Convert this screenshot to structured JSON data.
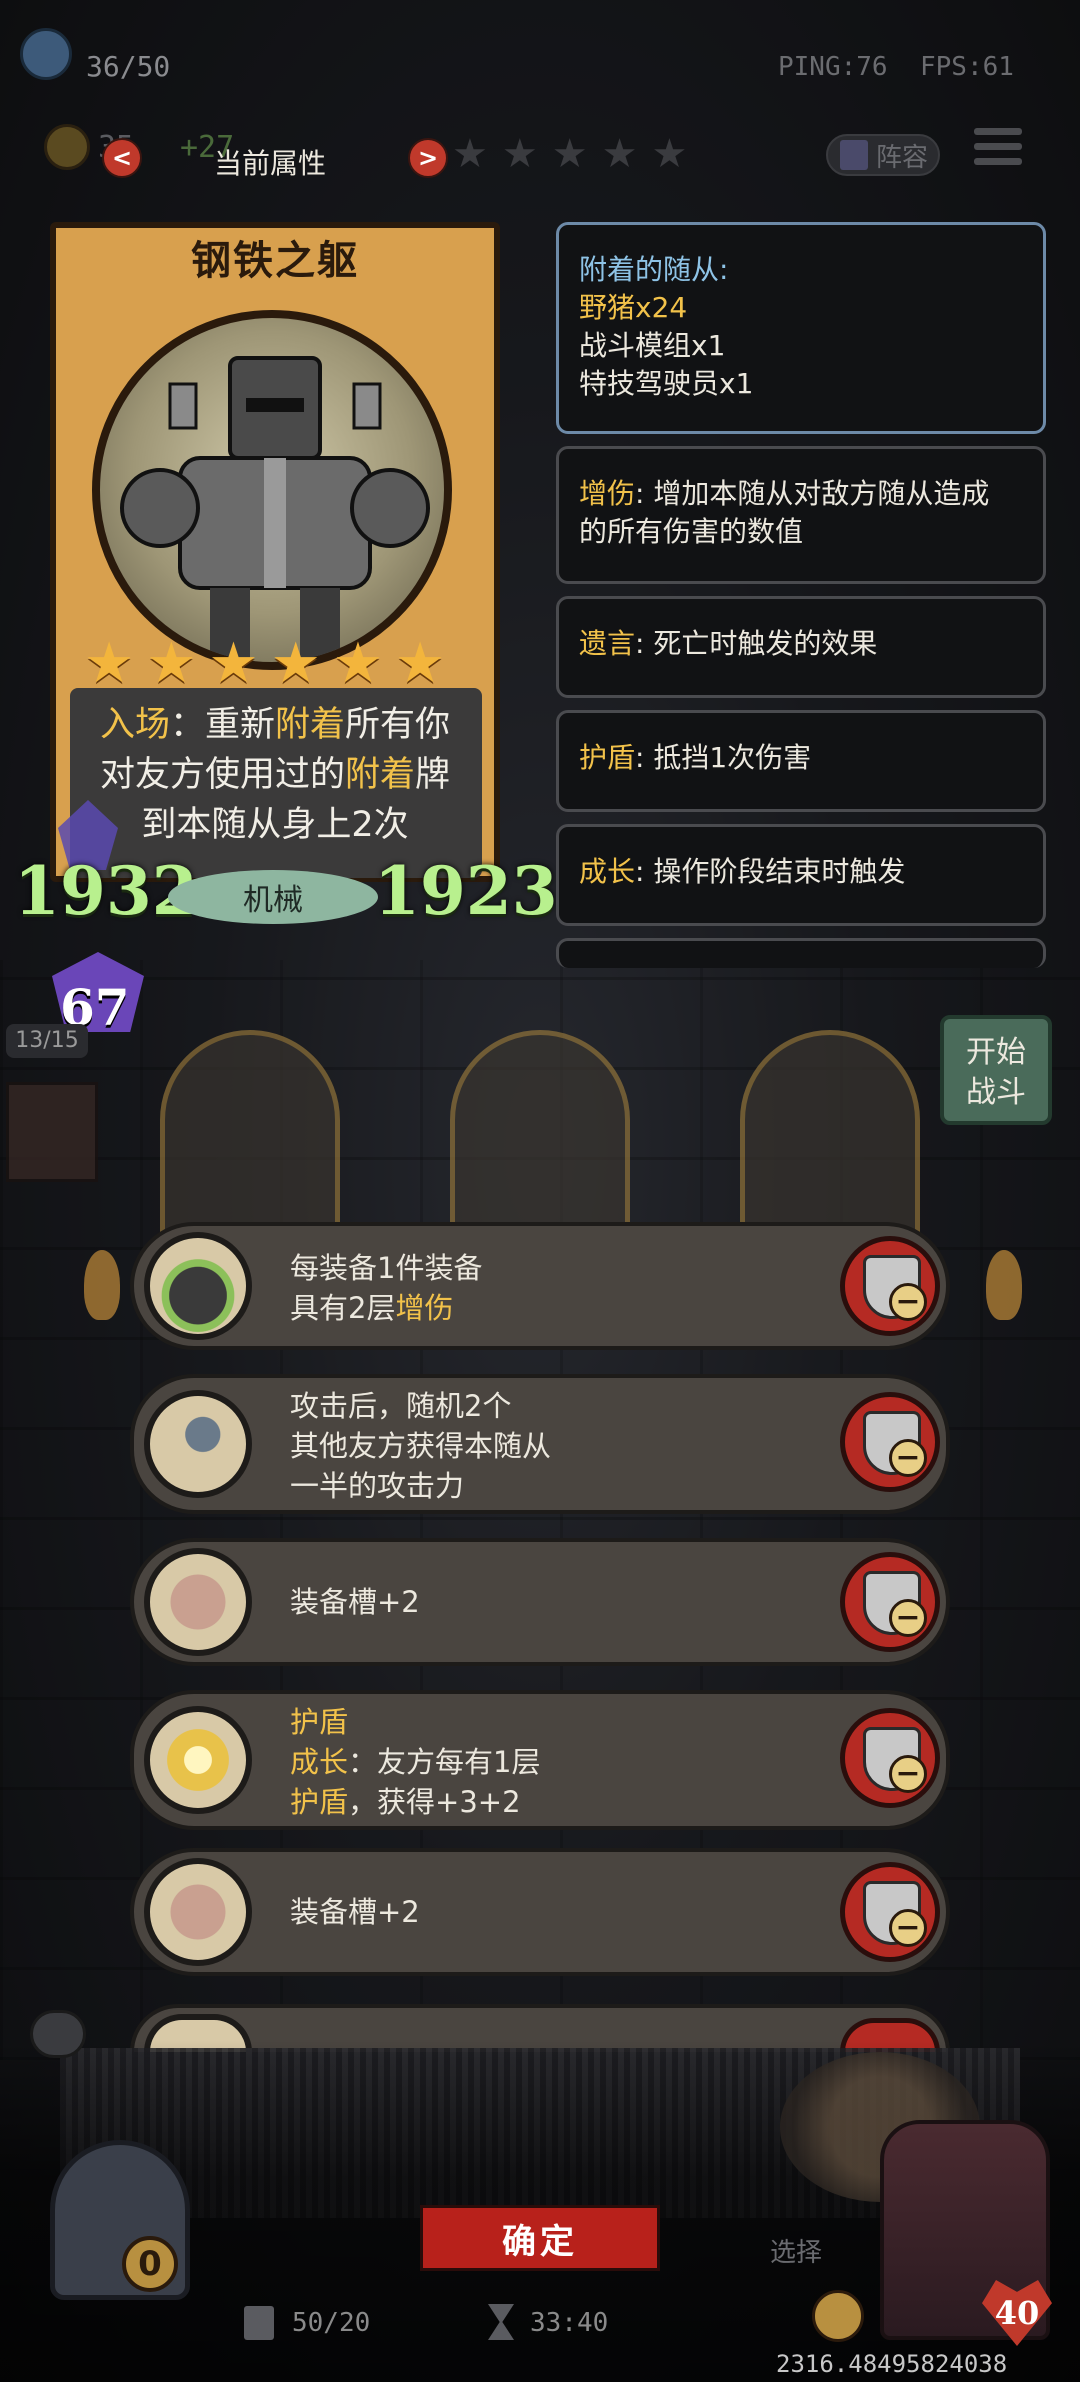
{
  "hud": {
    "gold_count": "36/50",
    "coins": "35",
    "coins_bonus": "+27",
    "ping": "PING:76",
    "fps": "FPS:61",
    "lineup_label": "阵容",
    "attribute_tab": "当前属性",
    "nav_prev": "<",
    "nav_next": ">"
  },
  "card": {
    "name": "钢铁之躯",
    "star_count": 6,
    "desc_line1_prefix": "入场",
    "desc_line1_rest": "：重新",
    "desc_line1_kw": "附着",
    "desc_line1_tail": "所有你",
    "desc_line2_prefix": "对友方使用过的",
    "desc_line2_kw": "附着",
    "desc_line2_tail": "牌",
    "desc_line3": "到本随从身上2次",
    "attack": "1932",
    "health": "1923",
    "tribe": "机械",
    "tier": "67"
  },
  "panels": {
    "attached_title": "附着的随从:",
    "attached_items": [
      "野猪x24",
      "战斗模组x1",
      "特技驾驶员x1"
    ],
    "bonus_damage_kw": "增伤",
    "bonus_damage_text": ": 增加本随从对敌方随从造成",
    "bonus_damage_text2": "的所有伤害的数值",
    "deathrattle_kw": "遗言",
    "deathrattle_text": ": 死亡时触发的效果",
    "shield_kw": "护盾",
    "shield_text": ": 抵挡1次伤害",
    "growth_kw": "成长",
    "growth_text": ": 操作阶段结束时触发"
  },
  "board": {
    "minion_count": "13/15",
    "start_battle_line1": "开始",
    "start_battle_line2": "战斗"
  },
  "options": [
    {
      "line1": "每装备1件装备",
      "line2_prefix": "具有2层",
      "line2_kw": "增伤"
    },
    {
      "line1": "攻击后，随机2个",
      "line2": "其他友方获得本随从",
      "line3": "一半的攻击力"
    },
    {
      "line1": "装备槽+2"
    },
    {
      "line1_kw": "护盾",
      "line2_kw": "成长",
      "line2_rest": "：友方每有1层",
      "line3_kw": "护盾",
      "line3_rest": "，获得+3+2"
    },
    {
      "line1": "装备槽+2"
    }
  ],
  "footer": {
    "confirm_label": "确定",
    "deck_count": "50/20",
    "timer": "33:40",
    "hand_count": "0",
    "hero_health": "40",
    "select_label": "选择",
    "coord": "2316.48495824038"
  },
  "colors": {
    "keyword": "#f2c24a",
    "stat_green": "#b8f08e",
    "confirm_red": "#b8211b"
  }
}
